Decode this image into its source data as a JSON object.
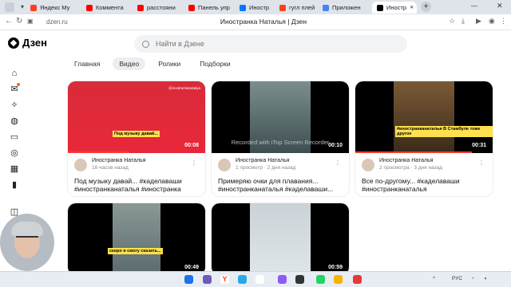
{
  "browser": {
    "tabs": [
      {
        "label": "Яндекс Му",
        "color": "#fc3f1d"
      },
      {
        "label": "Коммента",
        "color": "#ff0000"
      },
      {
        "label": "расстояни",
        "color": "#ff0000"
      },
      {
        "label": "Панель упр",
        "color": "#ff0000"
      },
      {
        "label": "Иностр",
        "color": "#0077ff"
      },
      {
        "label": "гугл плей",
        "color": "#fc3f1d"
      },
      {
        "label": "Приложен",
        "color": "#4285f4"
      },
      {
        "label": "Иностр",
        "color": "#000000"
      }
    ],
    "url": "dzen.ru",
    "page_title": "Иностранка Наталья | Дзен"
  },
  "header": {
    "logo": "Дзен",
    "search_placeholder": "Найти в Дзене"
  },
  "page_tabs": [
    "Главная",
    "Видео",
    "Ролики",
    "Подборки"
  ],
  "selected_tab": "Видео",
  "cards": [
    {
      "author": "Иностранка Наталья",
      "sub": "18 часов назад",
      "title": "Под музыку давай... #каделаваши #иностранканаталья #иностранка",
      "duration": "00:08",
      "caption": "Под музыку давай...",
      "handle": "@inostrankanatalya",
      "watermark": "",
      "progress": 0.45
    },
    {
      "author": "Иностранка Наталья",
      "sub": "1 просмотр · 2 дня назад",
      "title": "Примеряю очки для плавания... #иностранканаталья #каделаваши...",
      "duration": "00:10",
      "caption": "",
      "handle": "",
      "watermark": "Recorded with iTop Screen Recorder",
      "progress": 0
    },
    {
      "author": "Иностранка Наталья",
      "sub": "2 просмотра · 3 дня назад",
      "title": "Все по-другому... #каделаваши #иностранканаталья",
      "duration": "00:31",
      "caption": "#иностранканаталья В Стамбуле тоже другое",
      "handle": "",
      "watermark": "",
      "progress": 0.85
    },
    {
      "author": "",
      "sub": "",
      "title": "",
      "duration": "00:49",
      "caption": "скоро я смогу сказать...",
      "handle": "",
      "watermark": "",
      "progress": 0.6
    },
    {
      "author": "",
      "sub": "",
      "title": "",
      "duration": "00:59",
      "caption": "",
      "handle": "",
      "watermark": "",
      "progress": 0.6
    }
  ],
  "tray": {
    "lang": "РУС"
  }
}
